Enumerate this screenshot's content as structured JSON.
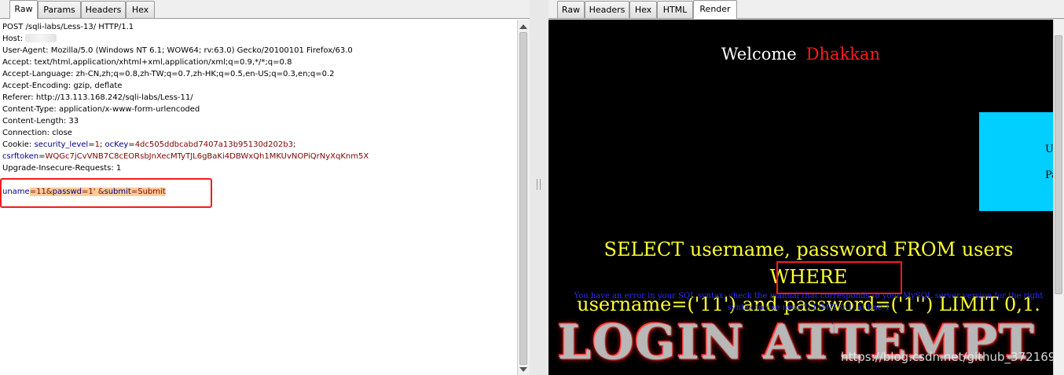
{
  "request_tabs": [
    "Raw",
    "Params",
    "Headers",
    "Hex"
  ],
  "request": {
    "line_post": "POST /sqli-labs/Less-13/ HTTP/1.1",
    "line_host": "Host: ",
    "line_ua": "User-Agent: Mozilla/5.0 (Windows NT 6.1; WOW64; rv:63.0) Gecko/20100101 Firefox/63.0",
    "line_accept": "Accept: text/html,application/xhtml+xml,application/xml;q=0.9,*/*;q=0.8",
    "line_lang": "Accept-Language: zh-CN,zh;q=0.8,zh-TW;q=0.7,zh-HK;q=0.5,en-US;q=0.3,en;q=0.2",
    "line_enc": "Accept-Encoding: gzip, deflate",
    "line_ref": "Referer: http://13.113.168.242/sqli-labs/Less-11/",
    "line_ctype": "Content-Type: application/x-www-form-urlencoded",
    "line_clen": "Content-Length: 33",
    "line_conn": "Connection: close",
    "cookie": {
      "prefix": "Cookie: ",
      "k1": "security_level",
      "eq1": "=",
      "v1": "1",
      "sep": "; ",
      "k2": "ocKey",
      "eq2": "=",
      "v2": "4dc505ddbcabd7407a13b95130d202b3",
      "end": ";"
    },
    "csrf": {
      "k": "csrftoken",
      "eq": "=",
      "v": "WQGc7jCvVNB7C8cEORsbJnXecMTyTJL6gBaKi4DBWxQh1MKUvNOPiQrNyXqKnm5X"
    },
    "line_upg": "Upgrade-Insecure-Requests: 1",
    "body": {
      "k1": "uname",
      "v1": "=11&",
      "k2": "passwd",
      "v2": "=1' &",
      "k3": "submit",
      "v3": "=Submit"
    }
  },
  "response_tabs": [
    "Raw",
    "Headers",
    "Hex",
    "HTML",
    "Render"
  ],
  "render": {
    "welcome": "Welcome",
    "name": "Dhakkan",
    "form_label_1": "Us",
    "form_label_2": "Pa",
    "query_line1": "SELECT username, password FROM users WHERE",
    "query_line2": "username=('11') and password=('1'') LIMIT 0,1.",
    "sql_error": "You have an error in your SQL syntax; check the manual that corresponds to your MySQL server version for the right syntax to use near '') LIMIT 0,1' at line 1",
    "login_attempt": "LOGIN ATTEMPT",
    "watermark": "https://blog.csdn.net/github_37216944"
  },
  "colors": {
    "highlight_box": "#ee1c1c",
    "query_text": "#ffff33",
    "error_text": "#2e2eff",
    "name_text": "#ff1a1a",
    "form_box": "#00cfff"
  }
}
